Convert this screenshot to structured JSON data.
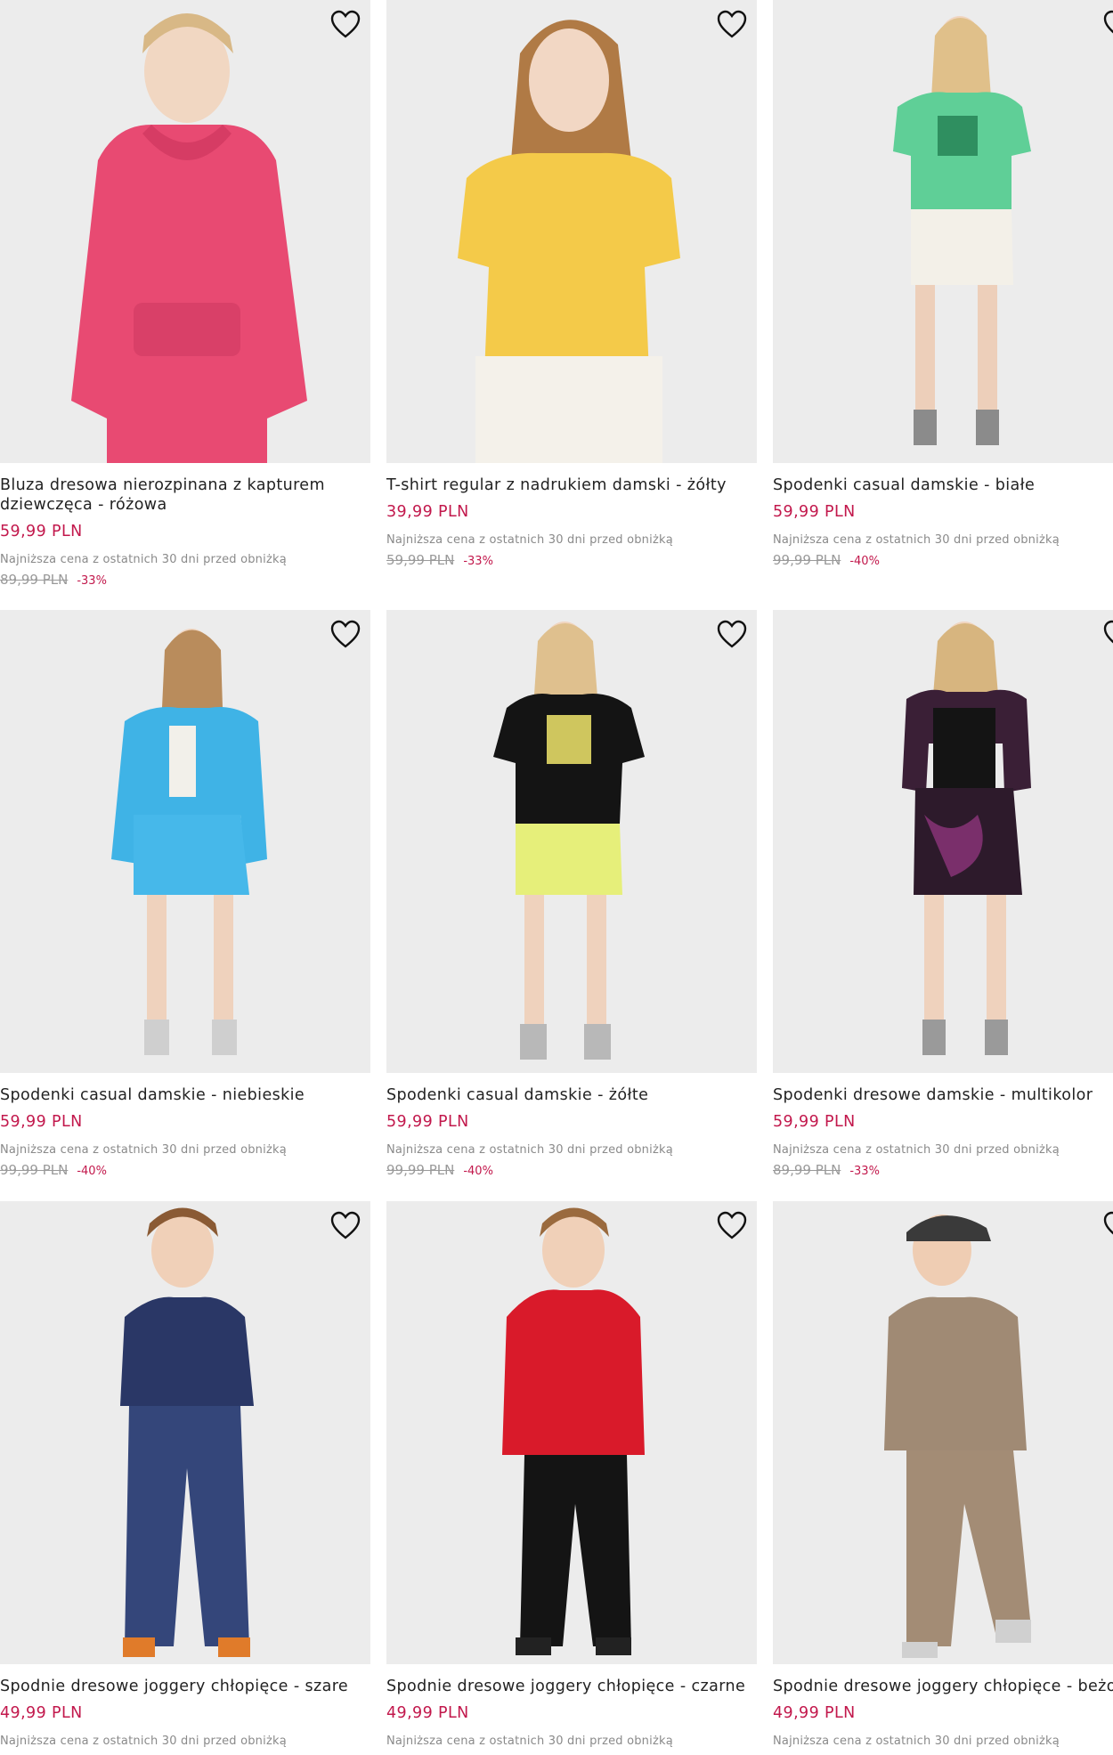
{
  "accent_color": "#c2184c",
  "products": [
    {
      "name": "Bluza dresowa nierozpinana z kapturem dziewczęca - różowa",
      "price": "59,99 PLN",
      "lowest_note": "Najniższa cena z ostatnich 30 dni przed obniżką",
      "old_price": "89,99 PLN",
      "discount": "-33%",
      "favorite_icon": "heart-outline-icon"
    },
    {
      "name": "T-shirt regular z nadrukiem damski - żółty",
      "price": "39,99 PLN",
      "lowest_note": "Najniższa cena z ostatnich 30 dni przed obniżką",
      "old_price": "59,99 PLN",
      "discount": "-33%",
      "favorite_icon": "heart-outline-icon"
    },
    {
      "name": "Spodenki casual damskie - białe",
      "price": "59,99 PLN",
      "lowest_note": "Najniższa cena z ostatnich 30 dni przed obniżką",
      "old_price": "99,99 PLN",
      "discount": "-40%",
      "favorite_icon": "heart-outline-icon"
    },
    {
      "name": "Spodenki casual damskie - niebieskie",
      "price": "59,99 PLN",
      "lowest_note": "Najniższa cena z ostatnich 30 dni przed obniżką",
      "old_price": "99,99 PLN",
      "discount": "-40%",
      "favorite_icon": "heart-outline-icon"
    },
    {
      "name": "Spodenki casual damskie - żółte",
      "price": "59,99 PLN",
      "lowest_note": "Najniższa cena z ostatnich 30 dni przed obniżką",
      "old_price": "99,99 PLN",
      "discount": "-40%",
      "favorite_icon": "heart-outline-icon"
    },
    {
      "name": "Spodenki dresowe damskie - multikolor",
      "price": "59,99 PLN",
      "lowest_note": "Najniższa cena z ostatnich 30 dni przed obniżką",
      "old_price": "89,99 PLN",
      "discount": "-33%",
      "favorite_icon": "heart-outline-icon"
    },
    {
      "name": "Spodnie dresowe joggery chłopięce - szare",
      "price": "49,99 PLN",
      "lowest_note": "Najniższa cena z ostatnich 30 dni przed obniżką",
      "favorite_icon": "heart-outline-icon"
    },
    {
      "name": "Spodnie dresowe joggery chłopięce - czarne",
      "price": "49,99 PLN",
      "lowest_note": "Najniższa cena z ostatnich 30 dni przed obniżką",
      "favorite_icon": "heart-outline-icon"
    },
    {
      "name": "Spodnie dresowe joggery chłopięce - beżowe",
      "price": "49,99 PLN",
      "lowest_note": "Najniższa cena z ostatnich 30 dni przed obniżką",
      "favorite_icon": "heart-outline-icon"
    }
  ]
}
